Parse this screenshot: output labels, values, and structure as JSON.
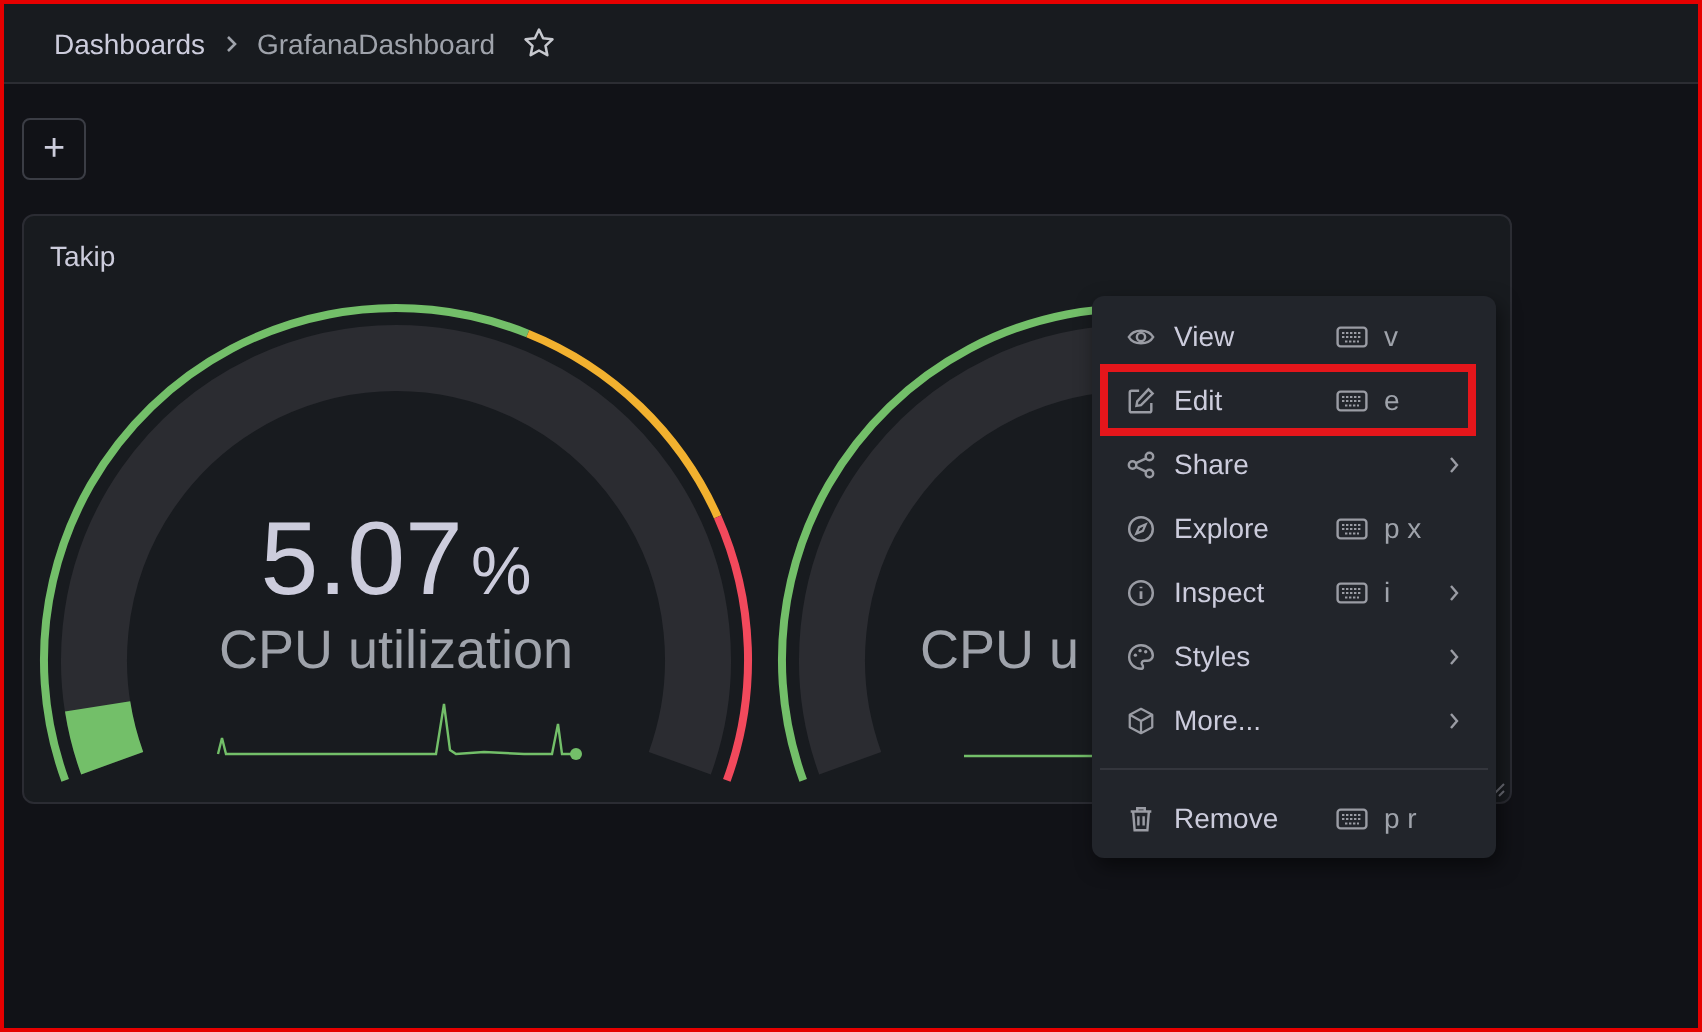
{
  "breadcrumb": [
    {
      "label": "Dashboards"
    },
    {
      "label": "GrafanaDashboard"
    }
  ],
  "starred": false,
  "add_button": "+",
  "panel": {
    "title": "Takip",
    "gauges": [
      {
        "value": "5.07",
        "unit": "%",
        "label": "CPU utilization",
        "level": 0.0507
      },
      {
        "label": "CPU u"
      }
    ]
  },
  "menu": {
    "groups": [
      {
        "items": [
          {
            "label": "View",
            "shortcut": "v",
            "submenu": false,
            "highlighted": false
          },
          {
            "label": "Edit",
            "shortcut": "e",
            "submenu": false,
            "highlighted": true
          },
          {
            "label": "Share",
            "submenu": true,
            "highlighted": false
          },
          {
            "label": "Explore",
            "shortcut": "p x",
            "submenu": false,
            "highlighted": false
          },
          {
            "label": "Inspect",
            "shortcut": "i",
            "submenu": true,
            "highlighted": false
          },
          {
            "label": "Styles",
            "submenu": true,
            "highlighted": false
          },
          {
            "label": "More...",
            "submenu": true,
            "highlighted": false
          }
        ]
      },
      {
        "items": [
          {
            "label": "Remove",
            "shortcut": "p r",
            "submenu": false,
            "highlighted": false
          }
        ]
      }
    ]
  }
}
